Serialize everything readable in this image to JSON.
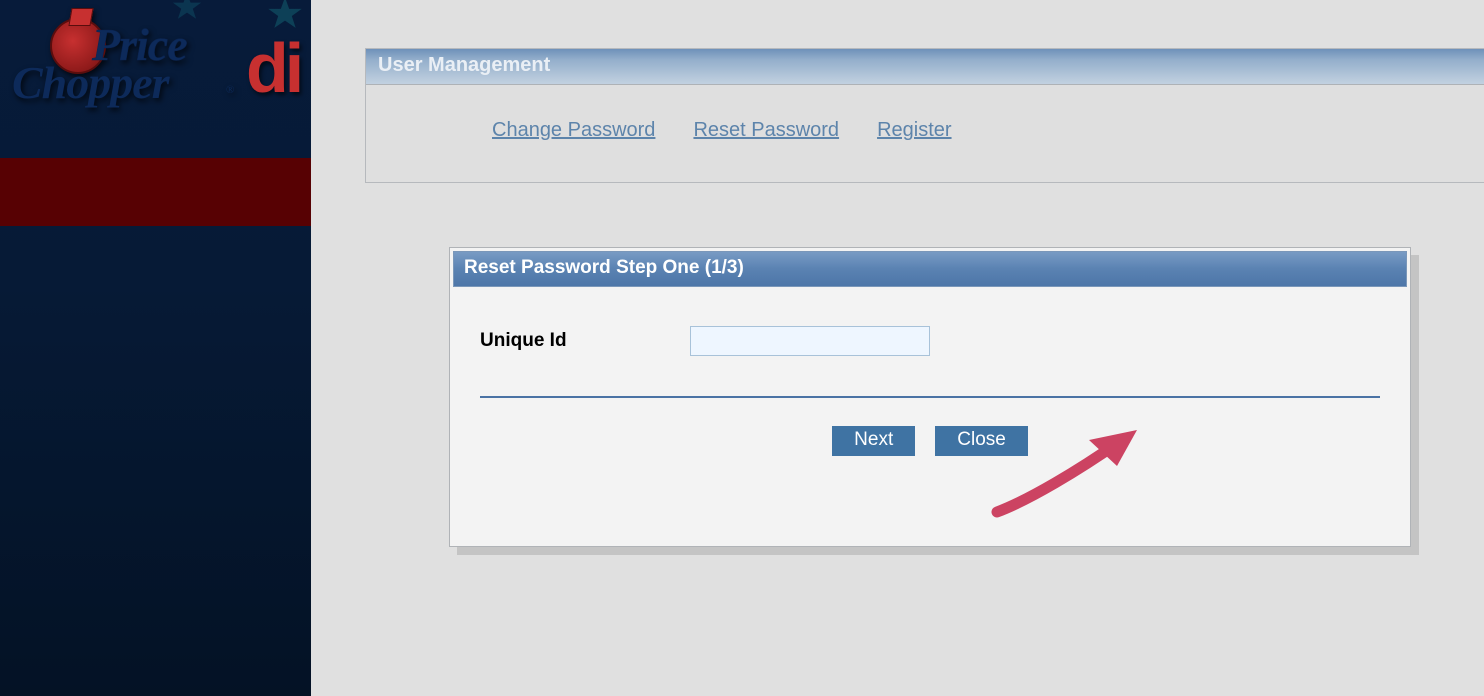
{
  "sidebar": {
    "logo_line1": "Price",
    "logo_line2": "Chopper",
    "logo_reg": "®",
    "extra_text": "di"
  },
  "um_panel": {
    "title": "User Management",
    "links": {
      "change_password": "Change Password",
      "reset_password": "Reset Password",
      "register": "Register"
    }
  },
  "dialog": {
    "title": "Reset Password Step One (1/3)",
    "unique_id_label": "Unique Id",
    "unique_id_value": "",
    "buttons": {
      "next": "Next",
      "close": "Close"
    }
  },
  "colors": {
    "accent": "#3f73a3",
    "annotation": "#cc4362"
  }
}
